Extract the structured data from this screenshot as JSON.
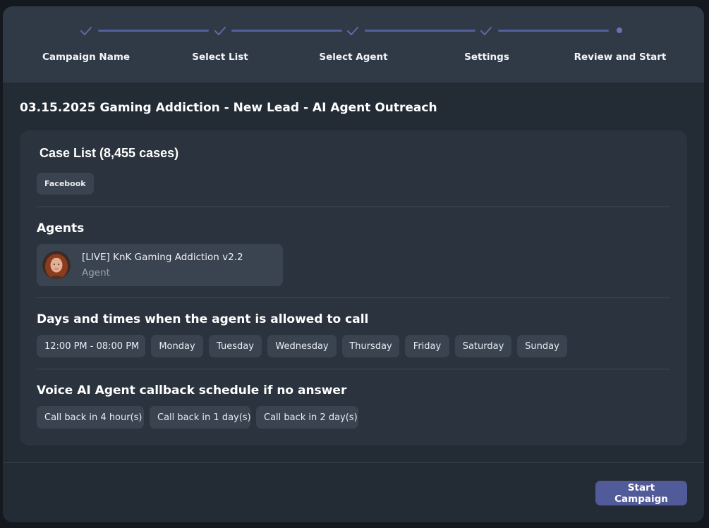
{
  "stepper": {
    "steps": [
      {
        "label": "Campaign Name",
        "status": "completed",
        "icon": "check-icon"
      },
      {
        "label": "Select List",
        "status": "completed",
        "icon": "check-icon"
      },
      {
        "label": "Select Agent",
        "status": "completed",
        "icon": "check-icon"
      },
      {
        "label": "Settings",
        "status": "completed",
        "icon": "check-icon"
      },
      {
        "label": "Review and Start",
        "status": "current",
        "icon": "dot-icon"
      }
    ]
  },
  "campaign": {
    "title": "03.15.2025 Gaming Addiction - New Lead - AI Agent Outreach"
  },
  "case_list": {
    "heading": "Case List (8,455 cases)",
    "tags": [
      "Facebook"
    ]
  },
  "agents": {
    "heading": "Agents",
    "items": [
      {
        "name": "[LIVE] KnK Gaming Addiction v2.2",
        "role": "Agent",
        "avatar": "agent-avatar"
      }
    ]
  },
  "schedule": {
    "heading": "Days and times when the agent is allowed to call",
    "time_range": "12:00 PM - 08:00 PM",
    "days": [
      "Monday",
      "Tuesday",
      "Wednesday",
      "Thursday",
      "Friday",
      "Saturday",
      "Sunday"
    ]
  },
  "callback": {
    "heading": "Voice AI Agent callback schedule if no answer",
    "items": [
      "Call back in 4 hour(s)",
      "Call back in 1 day(s)",
      "Call back in 2 day(s)"
    ]
  },
  "footer": {
    "start_label": "Start Campaign"
  },
  "colors": {
    "background": "#14191f",
    "modal": "#232b35",
    "header": "#303a46",
    "card": "#2b333e",
    "chip": "#3a4350",
    "accent": "#525b99",
    "step_line": "#535f9c"
  }
}
